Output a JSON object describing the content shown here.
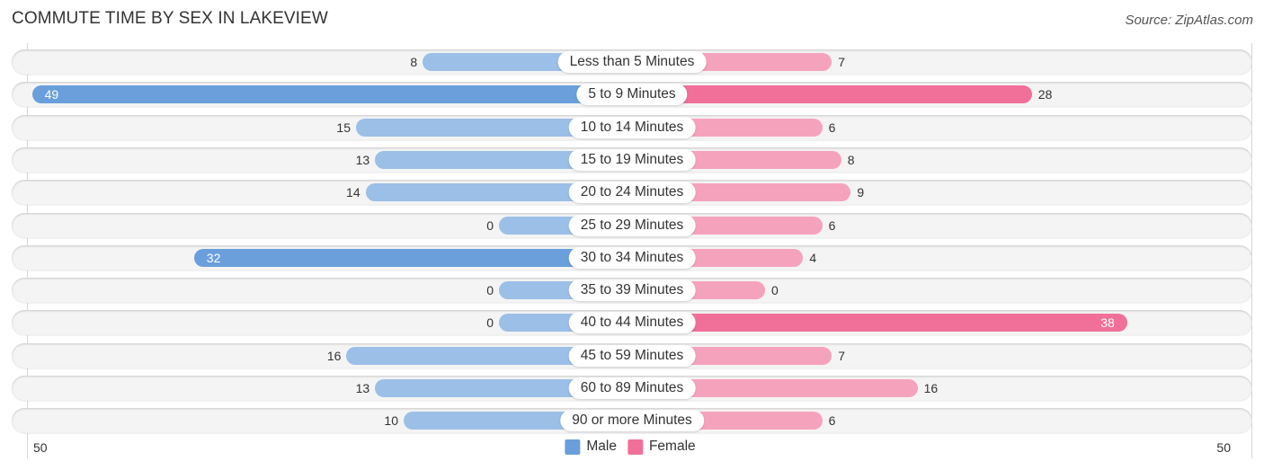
{
  "header": {
    "title": "COMMUTE TIME BY SEX IN LAKEVIEW",
    "source": "Source: ZipAtlas.com"
  },
  "colors": {
    "male": "#9bbfe6",
    "male_strong": "#6a9fdb",
    "female": "#f5a3bd",
    "female_strong": "#f07099",
    "row_bg": "#f4f4f4"
  },
  "chart_data": {
    "type": "bar",
    "orientation": "horizontal-diverging",
    "title": "COMMUTE TIME BY SEX IN LAKEVIEW",
    "categories": [
      "Less than 5 Minutes",
      "5 to 9 Minutes",
      "10 to 14 Minutes",
      "15 to 19 Minutes",
      "20 to 24 Minutes",
      "25 to 29 Minutes",
      "30 to 34 Minutes",
      "35 to 39 Minutes",
      "40 to 44 Minutes",
      "45 to 59 Minutes",
      "60 to 89 Minutes",
      "90 or more Minutes"
    ],
    "series": [
      {
        "name": "Male",
        "values": [
          8,
          49,
          15,
          13,
          14,
          0,
          32,
          0,
          0,
          16,
          13,
          10
        ]
      },
      {
        "name": "Female",
        "values": [
          7,
          28,
          6,
          8,
          9,
          6,
          4,
          0,
          38,
          7,
          16,
          6
        ]
      }
    ],
    "axis": {
      "left_label": "50",
      "right_label": "50",
      "range": [
        0,
        50
      ]
    },
    "legend": {
      "position": "bottom-center",
      "entries": [
        "Male",
        "Female"
      ]
    },
    "grid": false
  }
}
